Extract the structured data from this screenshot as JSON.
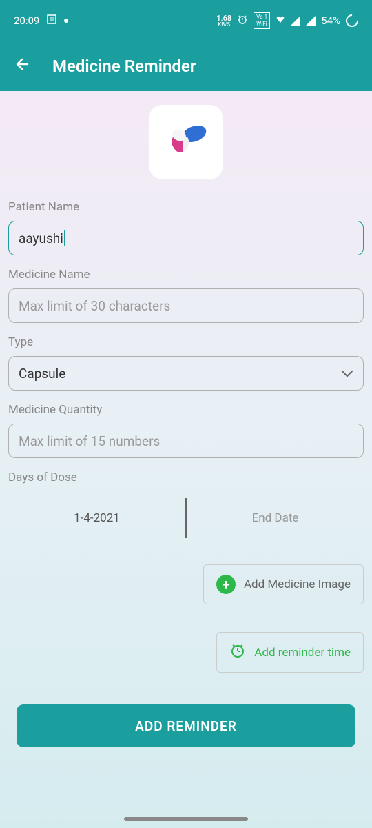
{
  "status": {
    "time": "20:09",
    "kbs_top": "1.68",
    "kbs_bot": "KB/S",
    "wifi_top": "Vo 1",
    "wifi_bot": "WiFi",
    "battery": "54%"
  },
  "app": {
    "title": "Medicine Reminder"
  },
  "form": {
    "patient_label": "Patient Name",
    "patient_value": "aayushi",
    "medicine_label": "Medicine Name",
    "medicine_placeholder": "Max limit of 30 characters",
    "type_label": "Type",
    "type_value": "Capsule",
    "qty_label": "Medicine Quantity",
    "qty_placeholder": "Max limit of 15 numbers",
    "days_label": "Days of Dose",
    "start_date": "1-4-2021",
    "end_date": "End Date",
    "add_image": "Add Medicine Image",
    "add_time": "Add reminder time",
    "submit": "ADD REMINDER"
  }
}
